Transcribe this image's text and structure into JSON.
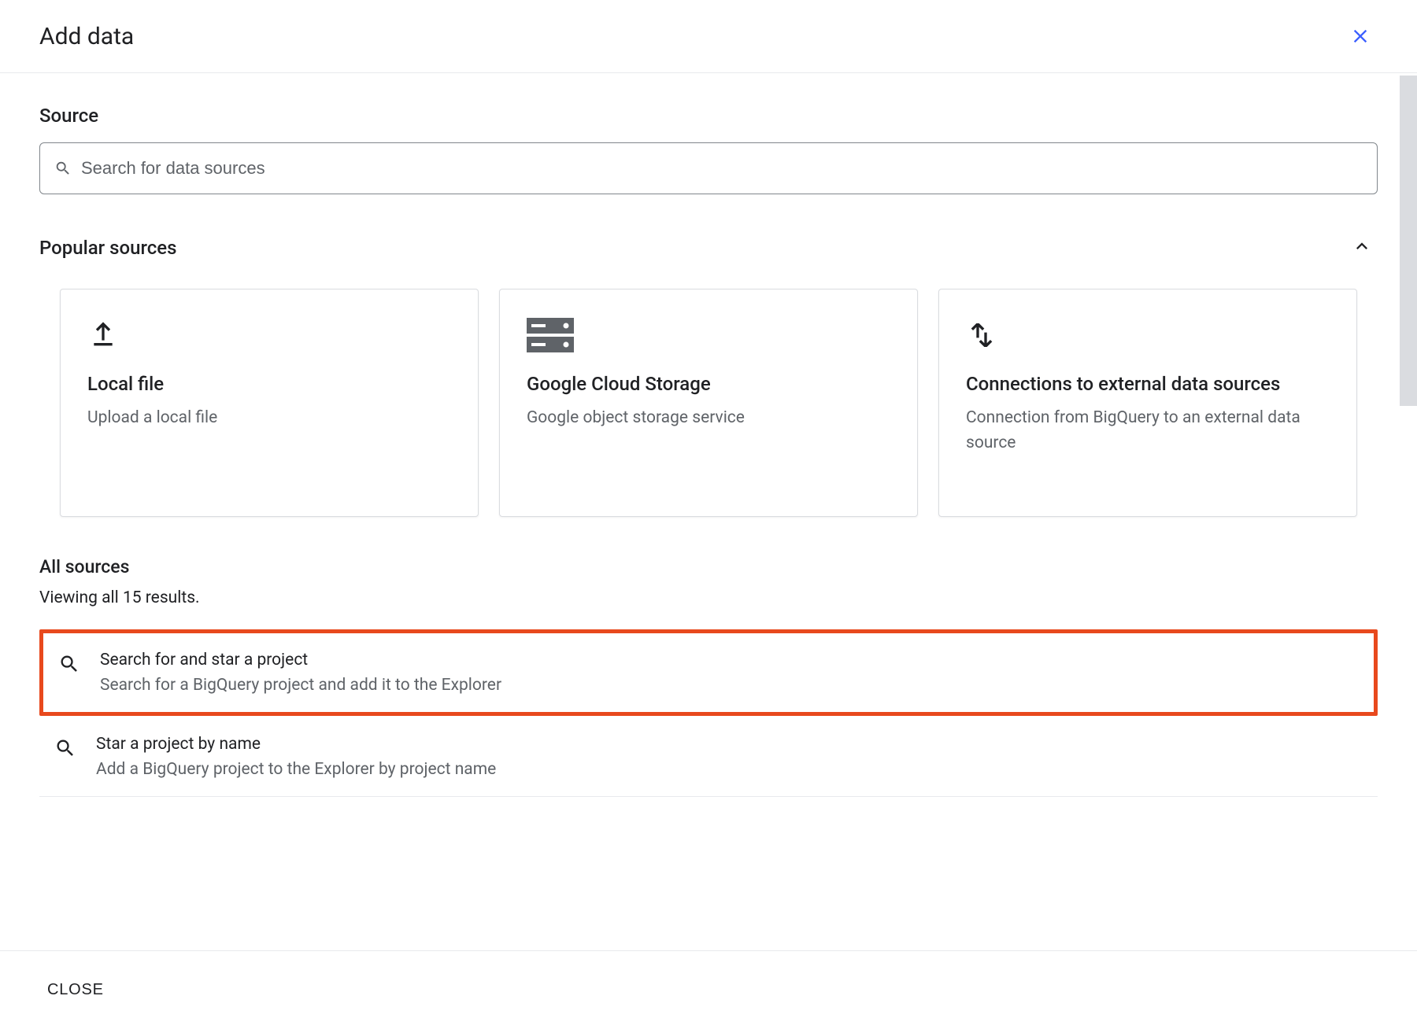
{
  "header": {
    "title": "Add data"
  },
  "source": {
    "heading": "Source",
    "search_placeholder": "Search for data sources"
  },
  "popular": {
    "heading": "Popular sources",
    "cards": [
      {
        "icon": "upload-icon",
        "title": "Local file",
        "desc": "Upload a local file"
      },
      {
        "icon": "storage-icon",
        "title": "Google Cloud Storage",
        "desc": "Google object storage service"
      },
      {
        "icon": "connections-icon",
        "title": "Connections to external data sources",
        "desc": "Connection from BigQuery to an external data source"
      }
    ]
  },
  "all_sources": {
    "heading": "All sources",
    "results_text": "Viewing all 15 results.",
    "items": [
      {
        "icon": "search-icon",
        "title": "Search for and star a project",
        "desc": "Search for a BigQuery project and add it to the Explorer",
        "highlighted": true
      },
      {
        "icon": "search-icon",
        "title": "Star a project by name",
        "desc": "Add a BigQuery project to the Explorer by project name",
        "highlighted": false
      }
    ]
  },
  "footer": {
    "close_label": "CLOSE"
  }
}
